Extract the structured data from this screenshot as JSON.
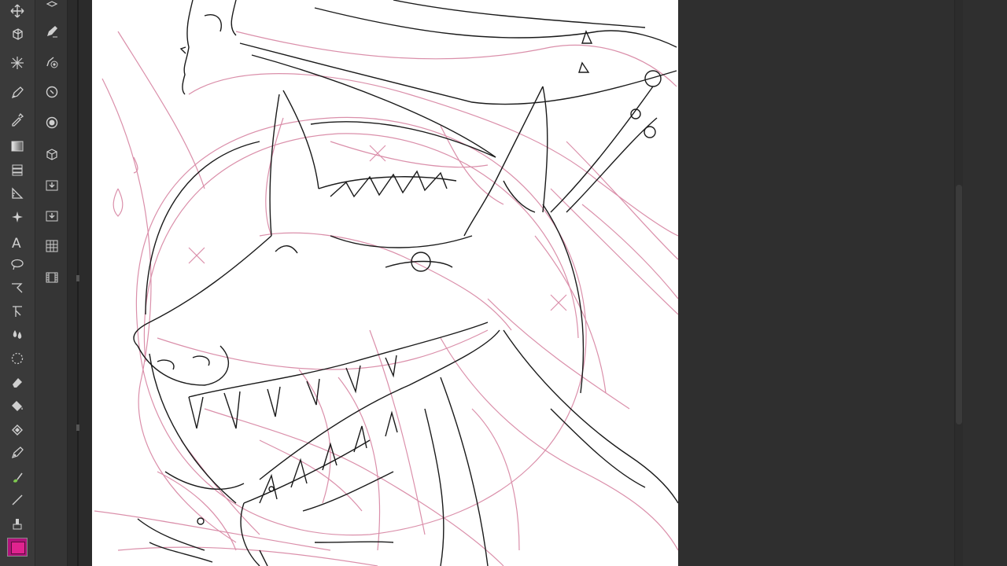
{
  "colors": {
    "sketch_pink": "#d98aa6",
    "lineart": "#1a1a1a",
    "current_color": "#e0238f",
    "panel_bg": "#3a3a3a",
    "workspace_bg": "#2f2f2f"
  },
  "tools": [
    {
      "name": "move-icon"
    },
    {
      "name": "transform-3d-icon"
    },
    {
      "name": "sparkle-icon"
    },
    {
      "name": "pen-icon"
    },
    {
      "name": "eyedropper-icon"
    },
    {
      "name": "gradient-icon"
    },
    {
      "name": "layers-icon"
    },
    {
      "name": "ruler-icon"
    },
    {
      "name": "text-icon"
    },
    {
      "name": "lasso-icon"
    },
    {
      "name": "selection-pen-icon"
    },
    {
      "name": "select-arrow-icon"
    },
    {
      "name": "blend-icon"
    },
    {
      "name": "marquee-icon"
    },
    {
      "name": "eraser-icon"
    },
    {
      "name": "fill-icon"
    },
    {
      "name": "fill-eraser-icon"
    },
    {
      "name": "vector-pen-icon"
    },
    {
      "name": "brush-icon"
    },
    {
      "name": "line-icon"
    },
    {
      "name": "stamp-icon"
    }
  ],
  "subtools": [
    {
      "name": "layer-stack-icon"
    },
    {
      "name": "brush-settings-icon"
    },
    {
      "name": "fill-target-icon"
    },
    {
      "name": "zoom-icon"
    },
    {
      "name": "circle-icon"
    },
    {
      "name": "3d-cube-icon"
    },
    {
      "name": "import-icon"
    },
    {
      "name": "export-icon"
    },
    {
      "name": "grid-icon"
    },
    {
      "name": "film-icon"
    }
  ]
}
